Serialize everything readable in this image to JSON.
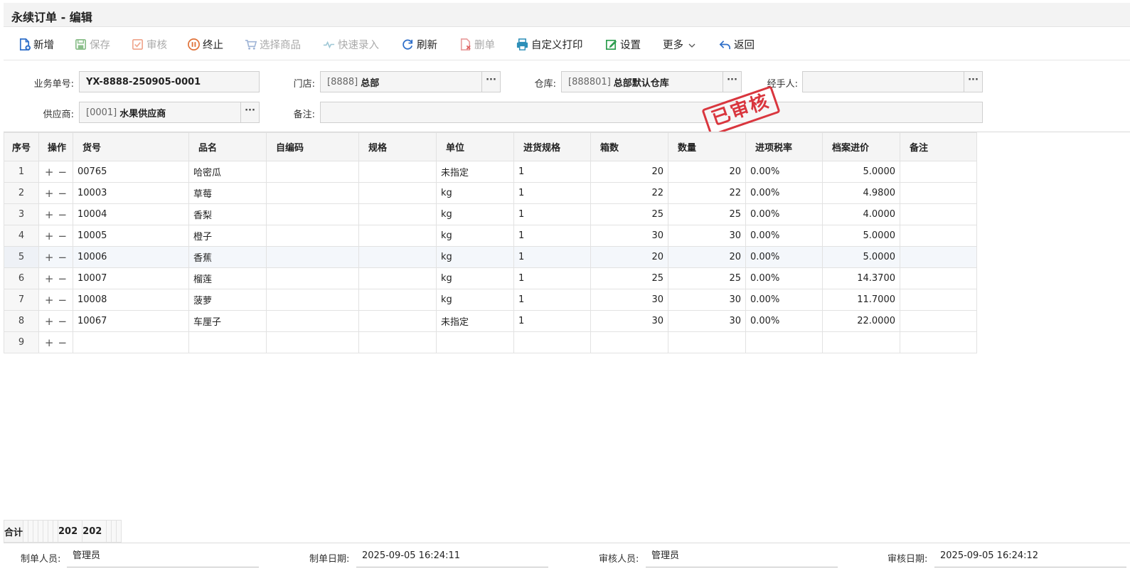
{
  "window": {
    "title": "永续订单 - 编辑"
  },
  "toolbar": {
    "new": "新增",
    "save": "保存",
    "audit": "审核",
    "terminate": "终止",
    "select_goods": "选择商品",
    "quick_entry": "快速录入",
    "refresh": "刷新",
    "delete": "删单",
    "custom_print": "自定义打印",
    "settings": "设置",
    "more": "更多",
    "back": "返回"
  },
  "form": {
    "doc_no_label": "业务单号:",
    "doc_no": "YX-8888-250905-0001",
    "store_label": "门店:",
    "store_code": "[8888]",
    "store_name": "总部",
    "warehouse_label": "仓库:",
    "warehouse_code": "[888801]",
    "warehouse_name": "总部默认仓库",
    "handler_label": "经手人:",
    "handler": "",
    "supplier_label": "供应商:",
    "supplier_code": "[0001]",
    "supplier_name": "水果供应商",
    "remark_label": "备注:",
    "remark": "",
    "dots": "···"
  },
  "stamp": "已审核",
  "table": {
    "headers": [
      "序号",
      "操作",
      "货号",
      "品名",
      "自编码",
      "规格",
      "单位",
      "进货规格",
      "箱数",
      "数量",
      "进项税率",
      "档案进价",
      "备注"
    ],
    "rows": [
      {
        "seq": "1",
        "code": "00765",
        "name": "哈密瓜",
        "selfcode": "",
        "spec": "",
        "unit": "未指定",
        "pack": "1",
        "boxes": "20",
        "qty": "20",
        "tax": "0.00%",
        "price": "5.0000",
        "note": ""
      },
      {
        "seq": "2",
        "code": "10003",
        "name": "草莓",
        "selfcode": "",
        "spec": "",
        "unit": "kg",
        "pack": "1",
        "boxes": "22",
        "qty": "22",
        "tax": "0.00%",
        "price": "4.9800",
        "note": ""
      },
      {
        "seq": "3",
        "code": "10004",
        "name": "香梨",
        "selfcode": "",
        "spec": "",
        "unit": "kg",
        "pack": "1",
        "boxes": "25",
        "qty": "25",
        "tax": "0.00%",
        "price": "4.0000",
        "note": ""
      },
      {
        "seq": "4",
        "code": "10005",
        "name": "橙子",
        "selfcode": "",
        "spec": "",
        "unit": "kg",
        "pack": "1",
        "boxes": "30",
        "qty": "30",
        "tax": "0.00%",
        "price": "5.0000",
        "note": ""
      },
      {
        "seq": "5",
        "code": "10006",
        "name": "香蕉",
        "selfcode": "",
        "spec": "",
        "unit": "kg",
        "pack": "1",
        "boxes": "20",
        "qty": "20",
        "tax": "0.00%",
        "price": "5.0000",
        "note": ""
      },
      {
        "seq": "6",
        "code": "10007",
        "name": "榴莲",
        "selfcode": "",
        "spec": "",
        "unit": "kg",
        "pack": "1",
        "boxes": "25",
        "qty": "25",
        "tax": "0.00%",
        "price": "14.3700",
        "note": ""
      },
      {
        "seq": "7",
        "code": "10008",
        "name": "菠萝",
        "selfcode": "",
        "spec": "",
        "unit": "kg",
        "pack": "1",
        "boxes": "30",
        "qty": "30",
        "tax": "0.00%",
        "price": "11.7000",
        "note": ""
      },
      {
        "seq": "8",
        "code": "10067",
        "name": "车厘子",
        "selfcode": "",
        "spec": "",
        "unit": "未指定",
        "pack": "1",
        "boxes": "30",
        "qty": "30",
        "tax": "0.00%",
        "price": "22.0000",
        "note": ""
      },
      {
        "seq": "9",
        "code": "",
        "name": "",
        "selfcode": "",
        "spec": "",
        "unit": "",
        "pack": "",
        "boxes": "",
        "qty": "",
        "tax": "",
        "price": "",
        "note": ""
      }
    ],
    "op_add": "+",
    "op_remove": "−",
    "totals": {
      "label": "合计",
      "boxes": "202",
      "qty": "202"
    }
  },
  "footer": {
    "creator_label": "制单人员:",
    "creator": "管理员",
    "create_date_label": "制单日期:",
    "create_date": "2025-09-05 16:24:11",
    "auditor_label": "审核人员:",
    "auditor": "管理员",
    "audit_date_label": "审核日期:",
    "audit_date": "2025-09-05 16:24:12"
  },
  "colors": {
    "accent_blue": "#2f6fc9",
    "stamp_red": "#d9363e",
    "save_green": "#8bbf8b",
    "delete_red": "#e9a0a0"
  }
}
